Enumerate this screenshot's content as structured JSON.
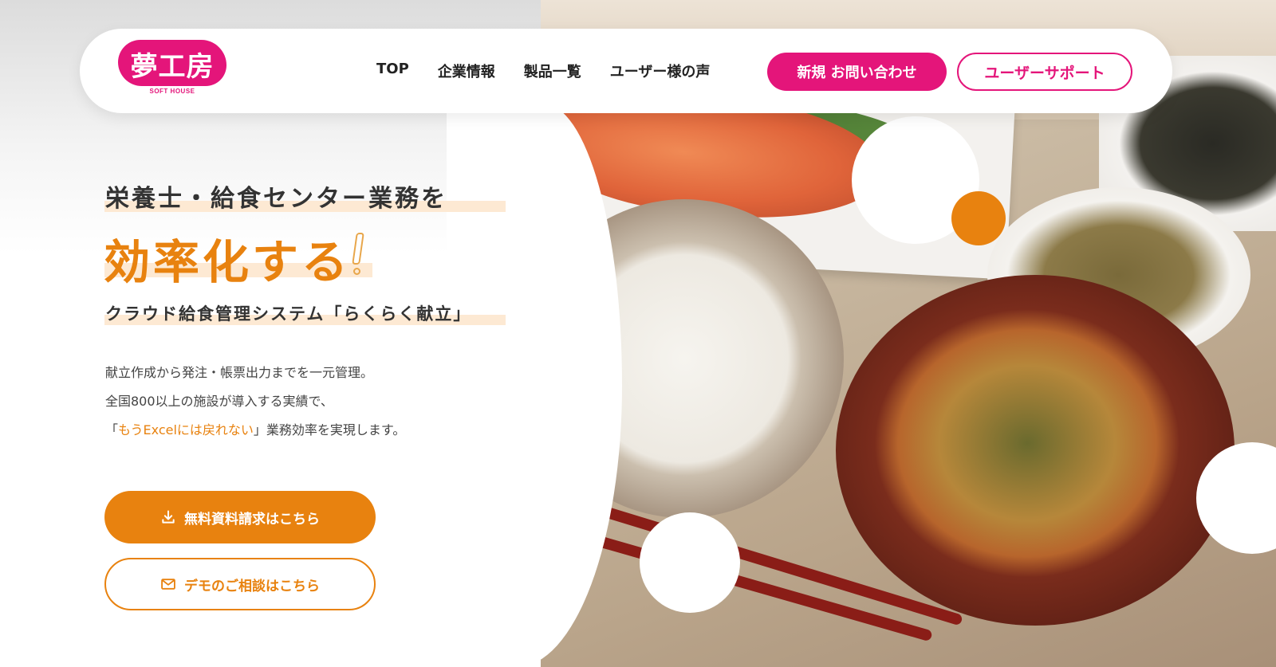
{
  "header": {
    "logo": {
      "text": "夢工房",
      "sub": "SOFT HOUSE"
    },
    "nav": [
      {
        "label": "TOP"
      },
      {
        "label": "企業情報"
      },
      {
        "label": "製品一覧"
      },
      {
        "label": "ユーザー様の声"
      }
    ],
    "inquiry_button": "新規 お問い合わせ",
    "support_button": "ユーザーサポート"
  },
  "hero": {
    "line1": "栄養士・給食センター業務を",
    "line2": "効率化する",
    "line3": "クラウド給食管理システム「らくらく献立」",
    "desc_line1": "献立作成から発注・帳票出力までを一元管理。",
    "desc_line2": "全国800以上の施設が導入する実績で、",
    "desc_line3_open": "「",
    "desc_line3_accent": "もうExcelには戻れない",
    "desc_line3_rest": "」業務効率を実現します。",
    "primary_button": "無料資料請求はこちら",
    "secondary_button": "デモのご相談はこちら"
  },
  "colors": {
    "brand_pink": "#e4157a",
    "accent_orange": "#e8820f",
    "highlight": "#fde9d3"
  },
  "icons": {
    "primary_button_icon": "download-icon",
    "secondary_button_icon": "mail-icon"
  }
}
